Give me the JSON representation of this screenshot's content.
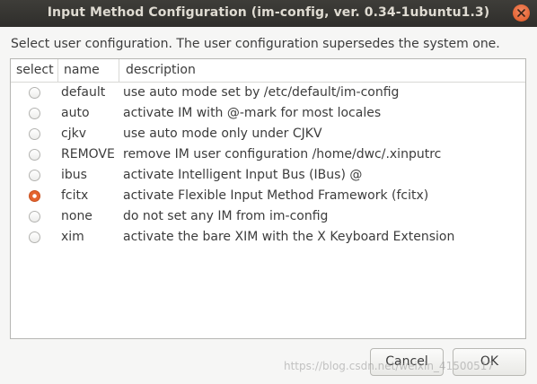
{
  "window": {
    "title": "Input Method Configuration (im-config, ver. 0.34-1ubuntu1.3)"
  },
  "instruction": "Select user configuration. The user configuration supersedes the system one.",
  "table": {
    "columns": [
      "select",
      "name",
      "description"
    ],
    "rows": [
      {
        "name": "default",
        "description": "use auto mode set by /etc/default/im-config",
        "selected": false
      },
      {
        "name": "auto",
        "description": "activate IM with @-mark for most locales",
        "selected": false
      },
      {
        "name": "cjkv",
        "description": "use auto mode only under CJKV",
        "selected": false
      },
      {
        "name": "REMOVE",
        "description": "remove IM user configuration /home/dwc/.xinputrc",
        "selected": false
      },
      {
        "name": "ibus",
        "description": "activate Intelligent Input Bus (IBus) @",
        "selected": false
      },
      {
        "name": "fcitx",
        "description": "activate Flexible Input Method Framework (fcitx)",
        "selected": true
      },
      {
        "name": "none",
        "description": "do not set any IM from im-config",
        "selected": false
      },
      {
        "name": "xim",
        "description": "activate the bare XIM with the X Keyboard Extension",
        "selected": false
      }
    ]
  },
  "buttons": {
    "cancel": "Cancel",
    "ok": "OK"
  },
  "watermark": "https://blog.csdn.net/weixin_41500517",
  "colors": {
    "titlebar": "#3c3b37",
    "accent": "#e4632e"
  }
}
